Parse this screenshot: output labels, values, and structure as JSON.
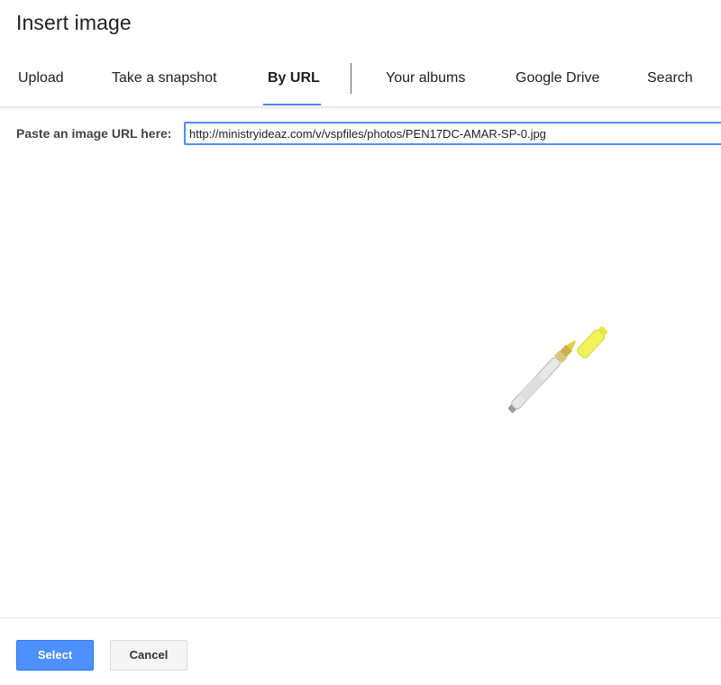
{
  "dialog": {
    "title": "Insert image"
  },
  "tabs": [
    {
      "label": "Upload"
    },
    {
      "label": "Take a snapshot"
    },
    {
      "label": "By URL",
      "active": true
    },
    {
      "label": "Your albums"
    },
    {
      "label": "Google Drive"
    },
    {
      "label": "Search"
    }
  ],
  "url_form": {
    "label": "Paste an image URL here:",
    "value": "http://ministryideaz.com/v/vspfiles/photos/PEN17DC-AMAR-SP-0.jpg"
  },
  "preview": {
    "image_icon": "highlighter-pen-image"
  },
  "footer": {
    "select_label": "Select",
    "cancel_label": "Cancel"
  },
  "colors": {
    "accent": "#4285f4",
    "primary_button": "#4d90fe",
    "highlighter_yellow": "#f2f25a"
  }
}
